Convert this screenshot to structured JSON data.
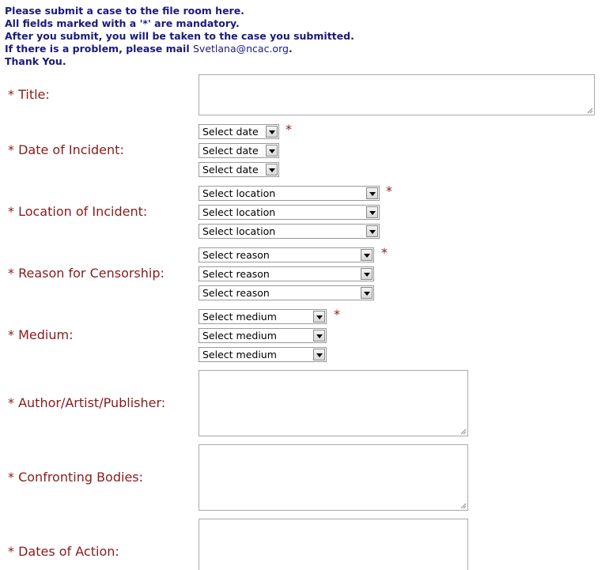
{
  "intro": {
    "line1": "Please submit a case to the file room here.",
    "line2": "All fields marked with a '*' are mandatory.",
    "line3": "After you submit, you will be taken to the case you submitted.",
    "line4_prefix": "If there is a problem, please mail ",
    "line4_email": "Svetlana@ncac.org",
    "line4_suffix": ".",
    "line5": "Thank You."
  },
  "required_mark": "*",
  "fields": {
    "title": {
      "label": "* Title:",
      "value": ""
    },
    "date": {
      "label": "* Date of Incident:",
      "selects": [
        "Select date",
        "Select date",
        "Select date"
      ]
    },
    "location": {
      "label": "* Location of Incident:",
      "selects": [
        "Select location",
        "Select location",
        "Select location"
      ]
    },
    "reason": {
      "label": "* Reason for Censorship:",
      "selects": [
        "Select reason",
        "Select reason",
        "Select reason"
      ]
    },
    "medium": {
      "label": "* Medium:",
      "selects": [
        "Select medium",
        "Select medium",
        "Select medium"
      ]
    },
    "author": {
      "label": "* Author/Artist/Publisher:",
      "value": ""
    },
    "bodies": {
      "label": "* Confronting Bodies:",
      "value": ""
    },
    "dates_action": {
      "label": "* Dates of Action:",
      "value": ""
    }
  }
}
